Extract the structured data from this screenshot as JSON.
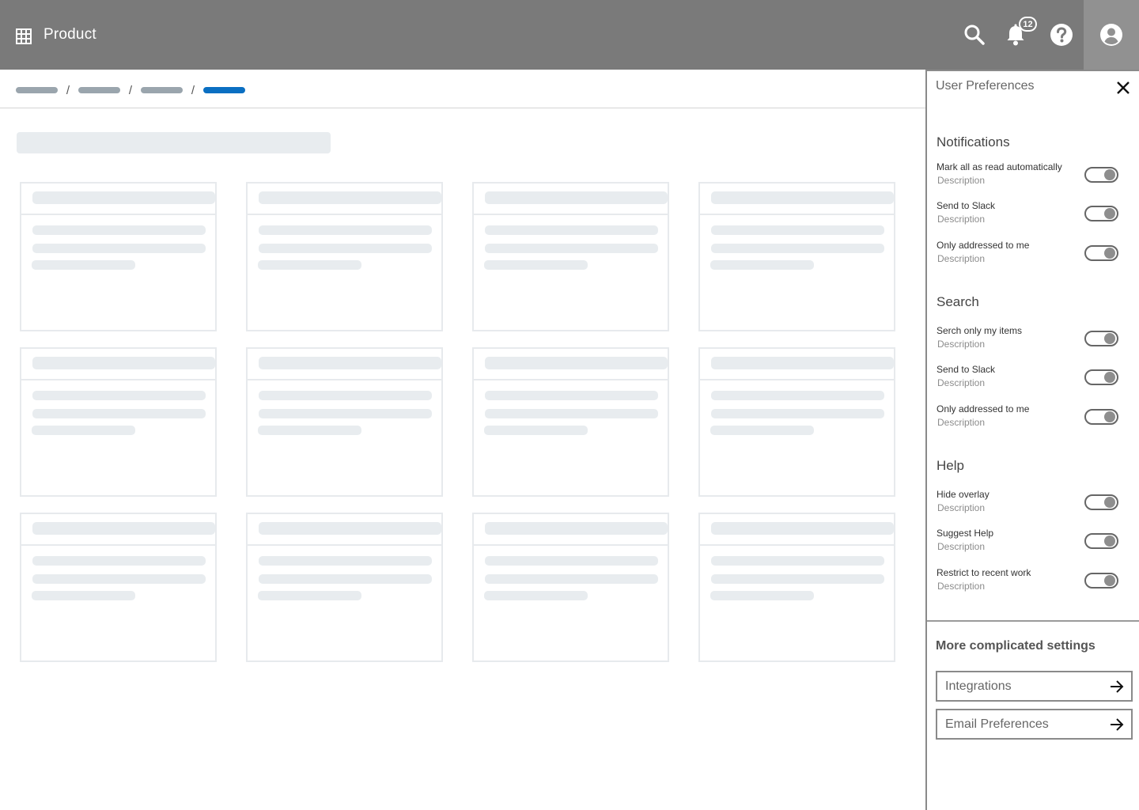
{
  "app": {
    "title": "Product"
  },
  "header": {
    "notification_count": "12",
    "icons": [
      "grid-icon",
      "search-icon",
      "bell-icon",
      "help-icon",
      "account-icon"
    ]
  },
  "colors": {
    "topbar": "#7a7a7a",
    "accent": "#0a6fc2",
    "skeleton": "#e8ecef"
  },
  "breadcrumb": {
    "separator": "/"
  },
  "preferences": {
    "title": "User Preferences",
    "sections": [
      {
        "title": "Notifications",
        "items": [
          {
            "label": "Mark all as read automatically",
            "description": "Description",
            "enabled": true
          },
          {
            "label": "Send to Slack",
            "description": "Description",
            "enabled": true
          },
          {
            "label": "Only addressed to me",
            "description": "Description",
            "enabled": true
          }
        ]
      },
      {
        "title": "Search",
        "items": [
          {
            "label": "Serch only my items",
            "description": "Description",
            "enabled": true
          },
          {
            "label": "Send to Slack",
            "description": "Description",
            "enabled": true
          },
          {
            "label": "Only addressed to me",
            "description": "Description",
            "enabled": true
          }
        ]
      },
      {
        "title": "Help",
        "items": [
          {
            "label": "Hide overlay",
            "description": "Description",
            "enabled": true
          },
          {
            "label": "Suggest Help",
            "description": "Description",
            "enabled": true
          },
          {
            "label": "Restrict to recent work",
            "description": "Description",
            "enabled": true
          }
        ]
      }
    ],
    "more_title": "More complicated settings",
    "links": [
      {
        "label": "Integrations"
      },
      {
        "label": "Email Preferences"
      }
    ]
  }
}
